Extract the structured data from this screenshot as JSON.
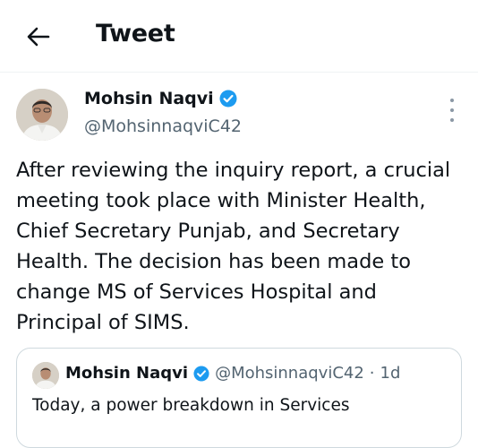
{
  "header": {
    "title": "Tweet",
    "back_icon": "arrow-left-icon"
  },
  "tweet": {
    "author_name": "Mohsin Naqvi",
    "handle": "@MohsinnaqviC42",
    "verified_color": "#1d9bf0",
    "text": "After reviewing the inquiry report, a crucial meeting took place with Minister Health, Chief Secretary Punjab, and Secretary Health. The decision has been made to change MS of Services Hospital and Principal of SIMS."
  },
  "quote": {
    "author_name": "Mohsin Naqvi",
    "handle": "@MohsinnaqviC42",
    "separator": "·",
    "time": "1d",
    "text": "Today, a power breakdown in Services"
  }
}
